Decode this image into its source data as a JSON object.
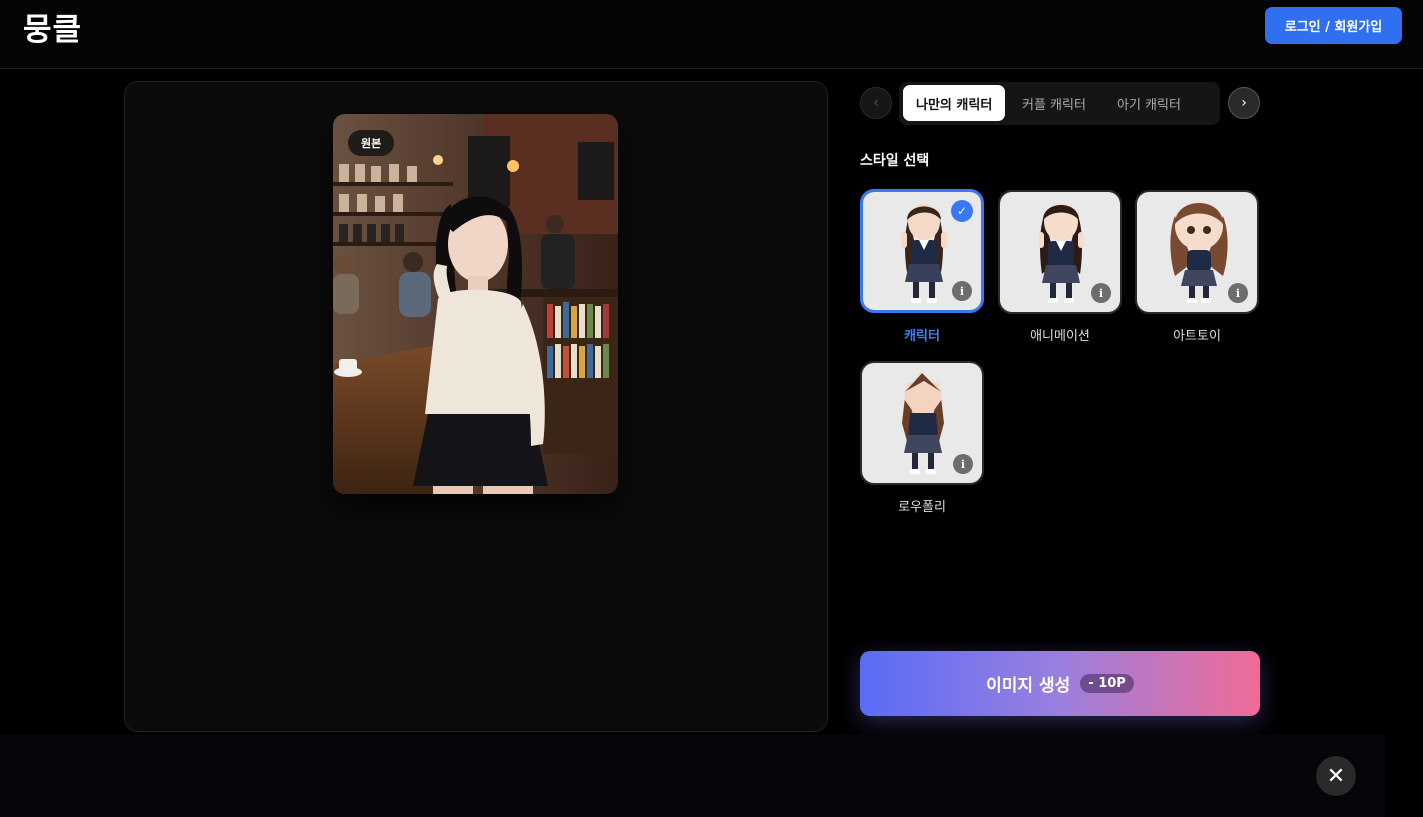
{
  "header": {
    "logo": "뭉클",
    "login_label": "로그인 / 회원가입"
  },
  "preview": {
    "badge": "원본"
  },
  "tabs": {
    "items": [
      {
        "label": "나만의 캐릭터",
        "active": true
      },
      {
        "label": "커플 캐릭터",
        "active": false
      },
      {
        "label": "아기 캐릭터",
        "active": false
      }
    ]
  },
  "styles": {
    "title": "스타일 선택",
    "items": [
      {
        "label": "캐릭터",
        "selected": true
      },
      {
        "label": "애니메이션",
        "selected": false
      },
      {
        "label": "아트토이",
        "selected": false
      },
      {
        "label": "로우폴리",
        "selected": false
      }
    ]
  },
  "generate": {
    "label": "이미지 생성",
    "cost": "- 10P"
  },
  "colors": {
    "accent": "#2f6ff0",
    "selected": "#3a78f2"
  }
}
